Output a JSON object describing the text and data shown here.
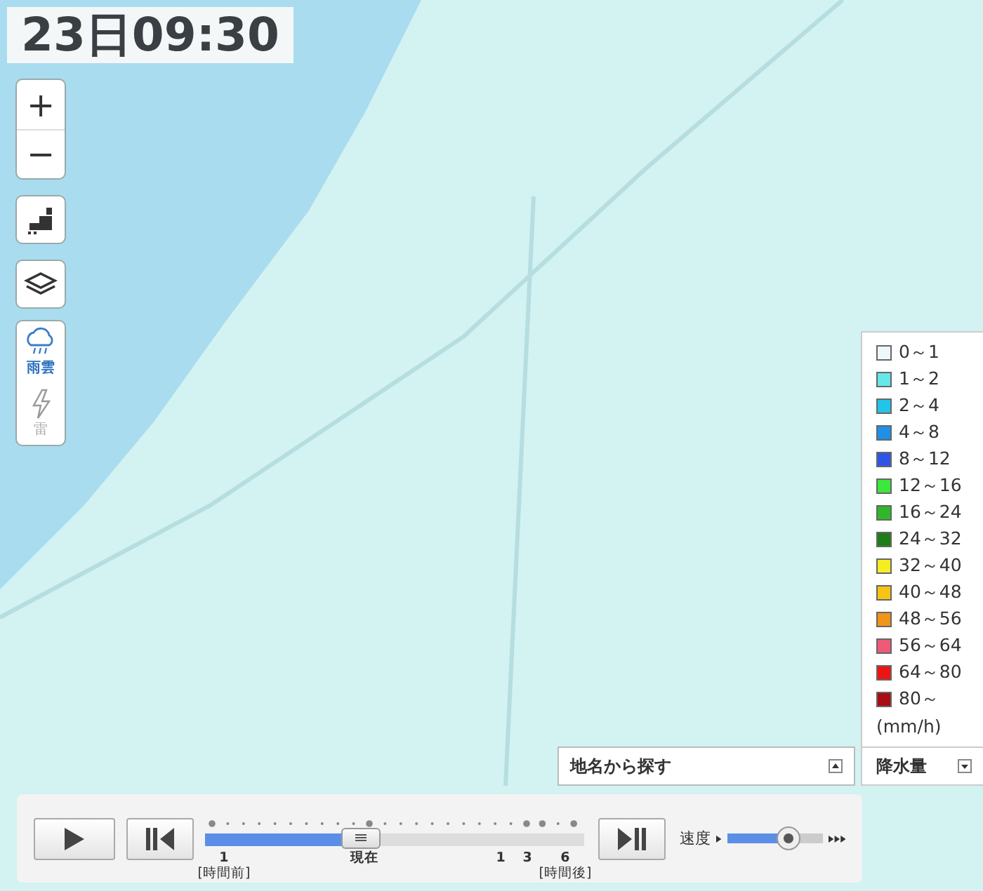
{
  "time": "23日09:30",
  "zoom": {
    "in": "+",
    "out": "−"
  },
  "layers": [
    {
      "kind": "rain",
      "label": "雨雲",
      "selected": true
    },
    {
      "kind": "thunder",
      "label": "雷",
      "selected": false
    }
  ],
  "legend": {
    "items": [
      {
        "label": "0～1",
        "color": "#eef8fa"
      },
      {
        "label": "1～2",
        "color": "#66e8e8"
      },
      {
        "label": "2～4",
        "color": "#22c4ea"
      },
      {
        "label": "4～8",
        "color": "#1e90e8"
      },
      {
        "label": "8～12",
        "color": "#2f55e6"
      },
      {
        "label": "12～16",
        "color": "#3ce83c"
      },
      {
        "label": "16～24",
        "color": "#2eb82a"
      },
      {
        "label": "24～32",
        "color": "#1e7e18"
      },
      {
        "label": "32～40",
        "color": "#f6ee22"
      },
      {
        "label": "40～48",
        "color": "#f6c414"
      },
      {
        "label": "48～56",
        "color": "#f0941a"
      },
      {
        "label": "56～64",
        "color": "#ee5a78"
      },
      {
        "label": "64～80",
        "color": "#ee1414"
      },
      {
        "label": "80～",
        "color": "#a80c14"
      }
    ],
    "unit": "(mm/h)",
    "select": "降水量"
  },
  "place_search": {
    "label": "地名から探す"
  },
  "player": {
    "timeline": {
      "level": 0.41,
      "ticks": [
        {
          "label": "1",
          "sub": "[時間前]"
        },
        {
          "label": "現在"
        },
        {
          "label": "1"
        },
        {
          "label": "3"
        },
        {
          "label": "6",
          "sub": "[時間後]"
        }
      ]
    },
    "speed": {
      "label": "速度",
      "level": 0.65
    }
  }
}
